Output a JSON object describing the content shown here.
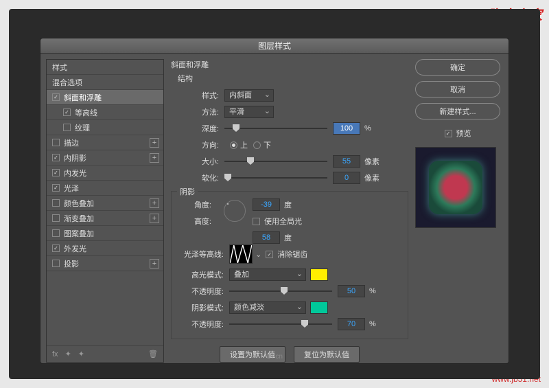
{
  "watermark": "脚本之家",
  "watermark_url": "www.jb51.net",
  "title": "图层样式",
  "sidebar": {
    "items": [
      {
        "label": "样式",
        "checked": null
      },
      {
        "label": "混合选项",
        "checked": null
      },
      {
        "label": "斜面和浮雕",
        "checked": true,
        "selected": true
      },
      {
        "label": "等高线",
        "checked": true,
        "sub": true
      },
      {
        "label": "纹理",
        "checked": false,
        "sub": true
      },
      {
        "label": "描边",
        "checked": false,
        "plus": true
      },
      {
        "label": "内阴影",
        "checked": true,
        "plus": true
      },
      {
        "label": "内发光",
        "checked": true
      },
      {
        "label": "光泽",
        "checked": true
      },
      {
        "label": "颜色叠加",
        "checked": false,
        "plus": true
      },
      {
        "label": "渐变叠加",
        "checked": false,
        "plus": true
      },
      {
        "label": "图案叠加",
        "checked": false
      },
      {
        "label": "外发光",
        "checked": true
      },
      {
        "label": "投影",
        "checked": false,
        "plus": true
      }
    ],
    "fx": "fx"
  },
  "panel": {
    "group_title": "斜面和浮雕",
    "structure": "结构",
    "style_lbl": "样式:",
    "style_val": "内斜面",
    "method_lbl": "方法:",
    "method_val": "平滑",
    "depth_lbl": "深度:",
    "depth_val": "100",
    "depth_unit": "%",
    "dir_lbl": "方向:",
    "dir_up": "上",
    "dir_down": "下",
    "size_lbl": "大小:",
    "size_val": "55",
    "size_unit": "像素",
    "soften_lbl": "软化:",
    "soften_val": "0",
    "soften_unit": "像素",
    "shadow_title": "阴影",
    "angle_lbl": "角度:",
    "angle_val": "-39",
    "angle_unit": "度",
    "global_lbl": "使用全局光",
    "alt_lbl": "高度:",
    "alt_val": "58",
    "alt_unit": "度",
    "gloss_lbl": "光泽等高线:",
    "aa_lbl": "消除锯齿",
    "hi_mode_lbl": "高光模式:",
    "hi_mode_val": "叠加",
    "hi_color": "#ffee00",
    "hi_op_lbl": "不透明度:",
    "hi_op_val": "50",
    "hi_op_unit": "%",
    "sh_mode_lbl": "阴影模式:",
    "sh_mode_val": "颜色减淡",
    "sh_color": "#00c89a",
    "sh_op_lbl": "不透明度:",
    "sh_op_val": "70",
    "sh_op_unit": "%",
    "default_btn": "设置为默认值",
    "reset_btn": "复位为默认值"
  },
  "right": {
    "ok": "确定",
    "cancel": "取消",
    "new_style": "新建样式...",
    "preview": "预览"
  },
  "ui_mark": "UI·cn"
}
